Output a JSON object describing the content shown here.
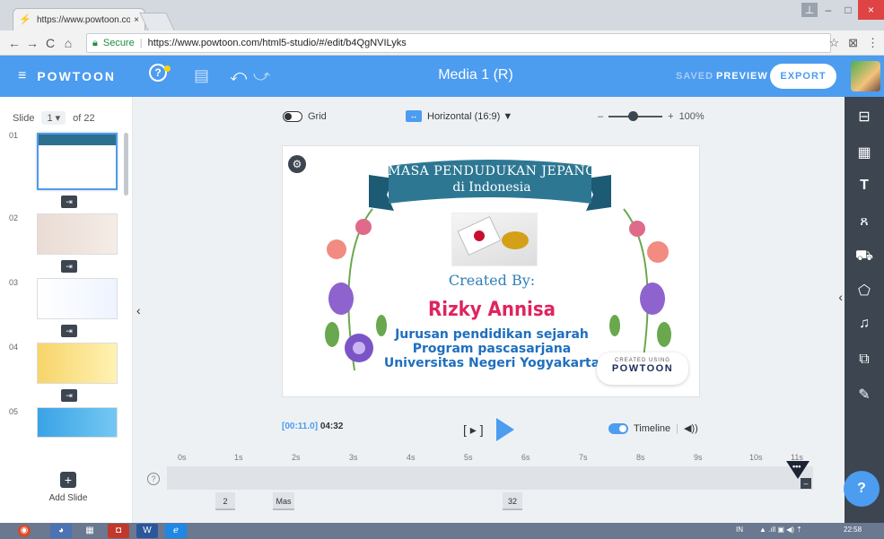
{
  "browser": {
    "tab_title": "https://www.powtoon.co",
    "tab_close": "×",
    "favicon": "⚡",
    "secure_label": "Secure",
    "url": "https://www.powtoon.com/html5-studio/#/edit/b4QgNVILyks",
    "back": "←",
    "forward": "→",
    "reload": "C",
    "home": "⌂",
    "star_icon": "☆",
    "menu_icon": "⋮",
    "ext_icon": "⊠",
    "minimize": "–",
    "maximize": "□",
    "close": "×",
    "profile": "⊥"
  },
  "topbar": {
    "logo": "POWTOON",
    "hamburger": "≡",
    "help_icon": "?",
    "notes_icon": "▤",
    "undo_icon": "⤺",
    "redo_icon": "⤻",
    "title": "Media 1 (R)",
    "saved": "SAVED",
    "preview": "PREVIEW",
    "export": "EXPORT"
  },
  "slides_panel": {
    "label": "Slide",
    "current": "1 ▾",
    "total": "of 22",
    "numbers": [
      "01",
      "02",
      "03",
      "04",
      "05"
    ],
    "transition_icon": "⇥",
    "add_slide_icon": "+",
    "add_slide": "Add Slide"
  },
  "stage_controls": {
    "grid_label": "Grid",
    "orientation_icon": "↔",
    "orientation": "Horizontal (16:9) ▼",
    "zoom_minus": "–",
    "zoom_plus": "+",
    "zoom_level": "100%",
    "zoom_fraction": 0.45,
    "collapse_left": "‹",
    "collapse_right": "‹"
  },
  "slide_content": {
    "gear_icon": "⚙",
    "banner_line1": "MASA PENDUDUKAN JEPANG",
    "banner_line2": "di Indonesia",
    "created_by": "Created By:",
    "author": "Rizky Annisa",
    "line1": "Jurusan pendidikan sejarah",
    "line2": "Program pascasarjana",
    "line3": "Universitas Negeri Yogyakarta",
    "badge_small": "CREATED USING",
    "badge_big": "POWTOON"
  },
  "playback": {
    "current_time": "[00:11.0]",
    "total_time": "04:32",
    "step_icon": "[ ▸ ]",
    "timeline_label": "Timeline",
    "sound_icon": "◀))"
  },
  "timeline": {
    "ticks": [
      "0s",
      "1s",
      "2s",
      "3s",
      "4s",
      "5s",
      "6s",
      "7s",
      "8s",
      "9s",
      "10s",
      "11s"
    ],
    "help": "?",
    "playhead_dots": "•••",
    "minus": "–",
    "markers": [
      "2",
      "Mas",
      "32"
    ]
  },
  "right_toolbar": {
    "icons": [
      "⊟",
      "▦",
      "T",
      "ጸ",
      "⛟",
      "⬠",
      "♫",
      "⧉",
      "✎"
    ]
  },
  "help_fab": "?",
  "taskbar": {
    "lang": "IN",
    "tray": "▲ .ıll ▣ ◀) ⇡",
    "clock": "22:58",
    "apps": [
      "◉",
      "◕",
      "▦",
      "◘",
      "W",
      "ℯ"
    ]
  }
}
